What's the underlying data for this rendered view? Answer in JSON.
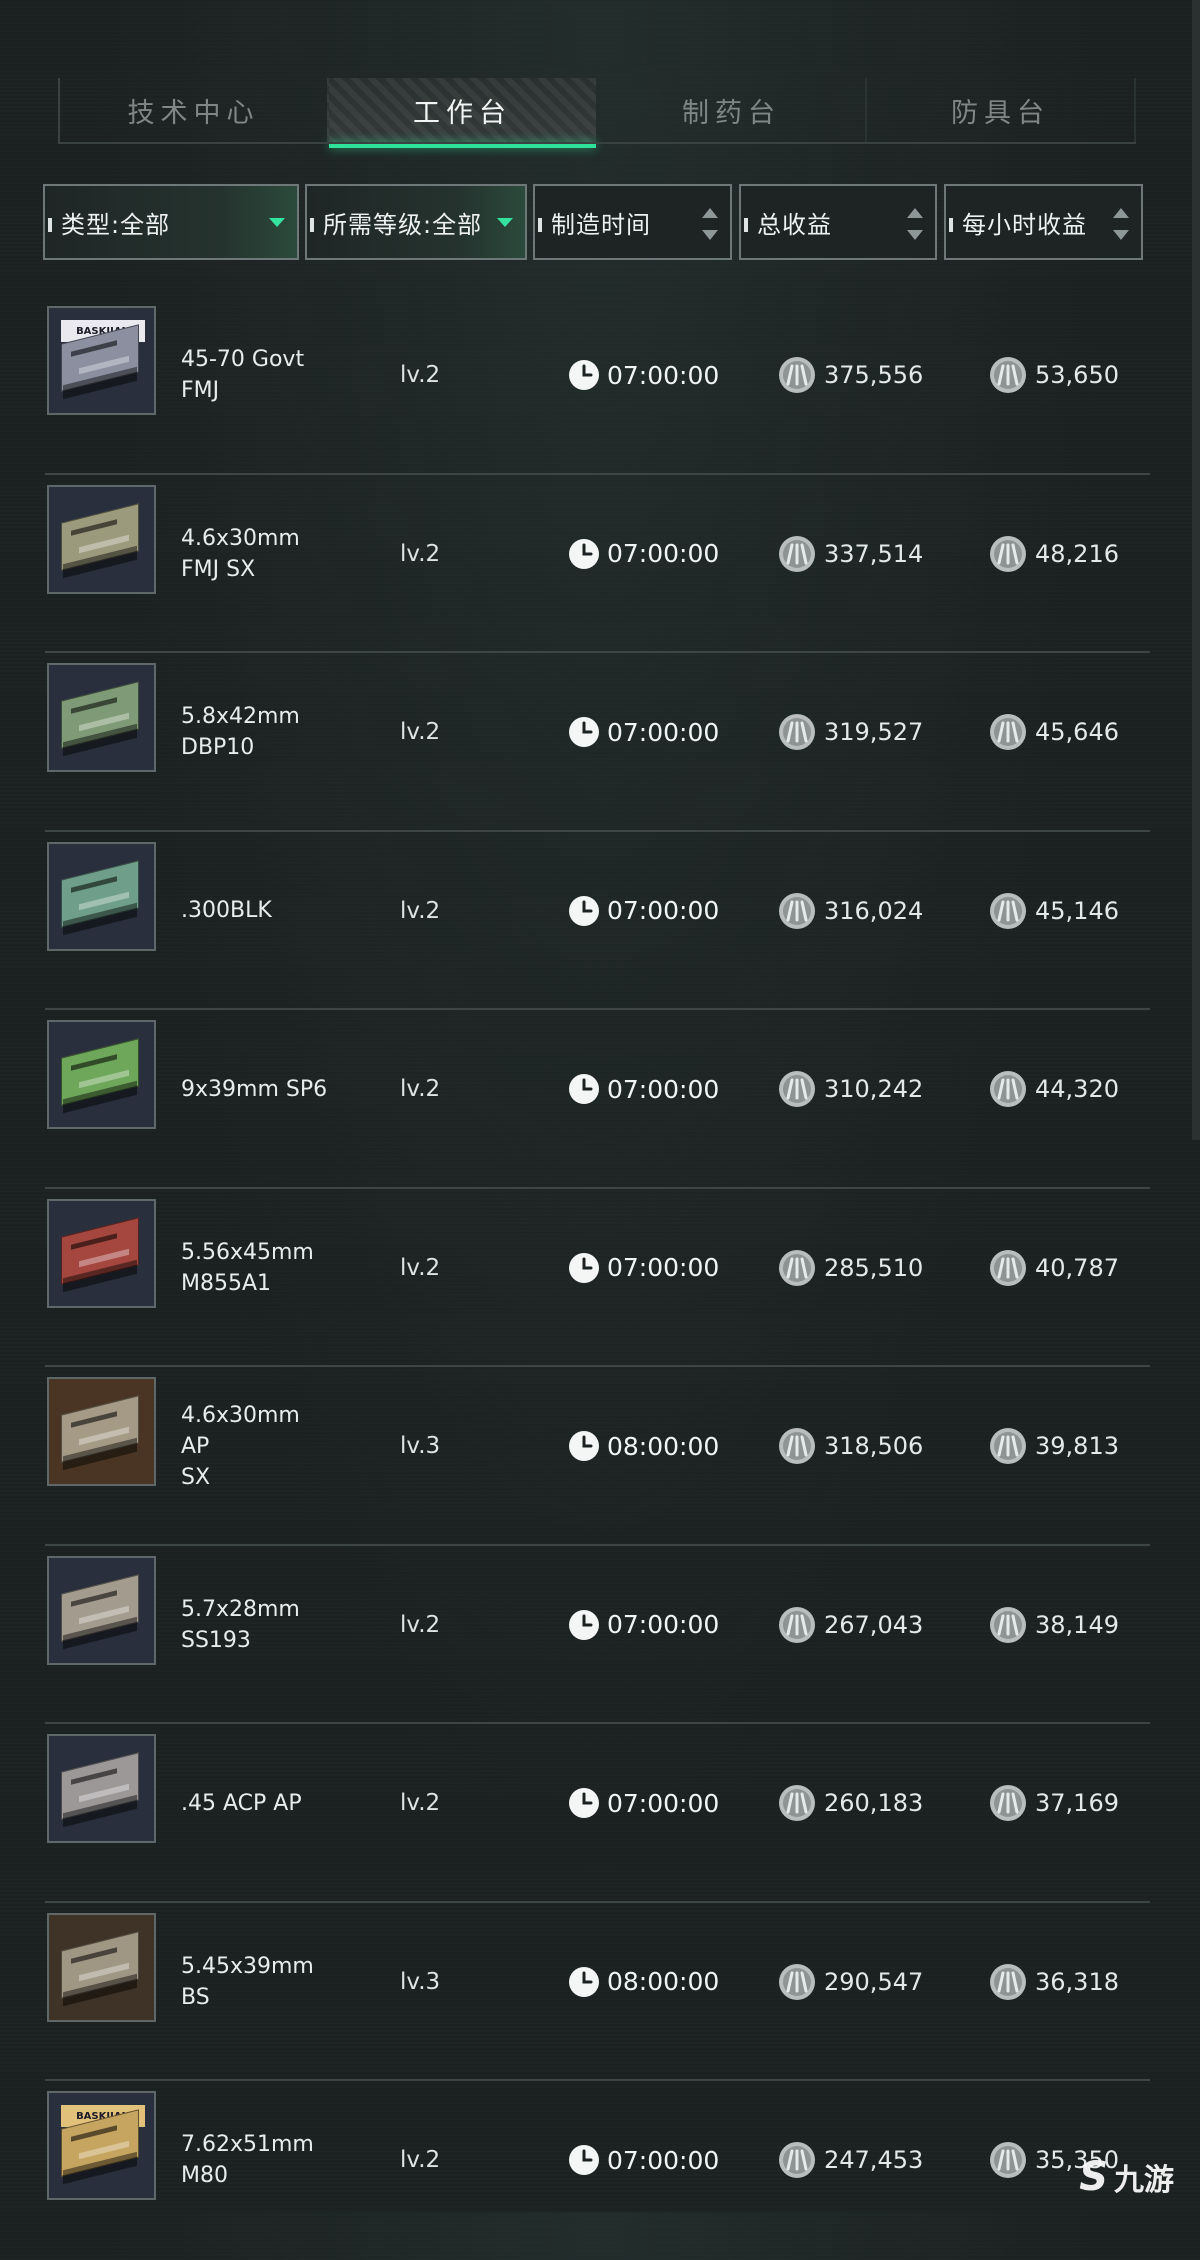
{
  "tabs": [
    {
      "label": "技术中心",
      "active": false
    },
    {
      "label": "工作台",
      "active": true
    },
    {
      "label": "制药台",
      "active": false
    },
    {
      "label": "防具台",
      "active": false
    }
  ],
  "filters": [
    {
      "label": "类型:全部",
      "kind": "dropdown"
    },
    {
      "label": "所需等级:全部",
      "kind": "dropdown"
    },
    {
      "label": "制造时间",
      "kind": "sort"
    },
    {
      "label": "总收益",
      "kind": "sort"
    },
    {
      "label": "每小时收益",
      "kind": "sort"
    }
  ],
  "rows": [
    {
      "name": "45-70 Govt\nFMJ",
      "level": "lv.2",
      "time": "07:00:00",
      "total": "375,556",
      "hourly": "53,650",
      "box_color": "#8b8fa0",
      "box_label": "BASKIJAN"
    },
    {
      "name": "4.6x30mm\nFMJ SX",
      "level": "lv.2",
      "time": "07:00:00",
      "total": "337,514",
      "hourly": "48,216",
      "box_color": "#9c9a7c"
    },
    {
      "name": "5.8x42mm\nDBP10",
      "level": "lv.2",
      "time": "07:00:00",
      "total": "319,527",
      "hourly": "45,646",
      "box_color": "#7f9a76"
    },
    {
      "name": ".300BLK",
      "level": "lv.2",
      "time": "07:00:00",
      "total": "316,024",
      "hourly": "45,146",
      "box_color": "#6f9f8a"
    },
    {
      "name": "9x39mm SP6",
      "level": "lv.2",
      "time": "07:00:00",
      "total": "310,242",
      "hourly": "44,320",
      "box_color": "#6ea75a"
    },
    {
      "name": "5.56x45mm\nM855A1",
      "level": "lv.2",
      "time": "07:00:00",
      "total": "285,510",
      "hourly": "40,787",
      "box_color": "#a5463f"
    },
    {
      "name": "4.6x30mm AP\nSX",
      "level": "lv.3",
      "time": "08:00:00",
      "total": "318,506",
      "hourly": "39,813",
      "box_color": "#a59a86",
      "bg": "#4a3524"
    },
    {
      "name": "5.7x28mm\nSS193",
      "level": "lv.2",
      "time": "07:00:00",
      "total": "267,043",
      "hourly": "38,149",
      "box_color": "#a39c8e"
    },
    {
      "name": ".45 ACP AP",
      "level": "lv.2",
      "time": "07:00:00",
      "total": "260,183",
      "hourly": "37,169",
      "box_color": "#9c9898"
    },
    {
      "name": "5.45x39mm\nBS",
      "level": "lv.3",
      "time": "08:00:00",
      "total": "290,547",
      "hourly": "36,318",
      "box_color": "#a09684",
      "bg": "#3f3226"
    },
    {
      "name": "7.62x51mm\nM80",
      "level": "lv.2",
      "time": "07:00:00",
      "total": "247,453",
      "hourly": "35,350",
      "box_color": "#c6a560",
      "box_label": "BASKIJAN"
    }
  ],
  "watermark": {
    "logo": "S",
    "text": "九游"
  },
  "colors": {
    "accent": "#2fe29b",
    "background": "#1b2020"
  }
}
